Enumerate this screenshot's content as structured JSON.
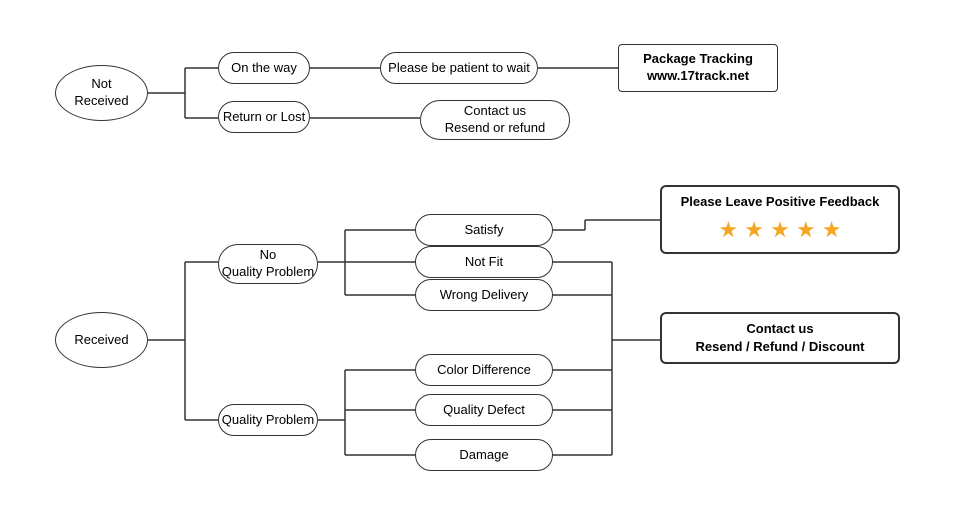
{
  "nodes": {
    "not_received": {
      "label": "Not\nReceived"
    },
    "on_the_way": {
      "label": "On the way"
    },
    "return_or_lost": {
      "label": "Return or Lost"
    },
    "please_patient": {
      "label": "Please be patient to wait"
    },
    "package_tracking": {
      "label": "Package Tracking\nwww.17track.net"
    },
    "contact_resend_refund": {
      "label": "Contact us\nResend or refund"
    },
    "received": {
      "label": "Received"
    },
    "no_quality_problem": {
      "label": "No\nQuality Problem"
    },
    "quality_problem": {
      "label": "Quality Problem"
    },
    "satisfy": {
      "label": "Satisfy"
    },
    "not_fit": {
      "label": "Not Fit"
    },
    "wrong_delivery": {
      "label": "Wrong Delivery"
    },
    "color_difference": {
      "label": "Color Difference"
    },
    "quality_defect": {
      "label": "Quality Defect"
    },
    "damage": {
      "label": "Damage"
    },
    "please_feedback": {
      "label": "Please Leave Positive Feedback"
    },
    "contact_resend_refund_discount": {
      "label": "Contact us\nResend / Refund / Discount"
    },
    "stars": {
      "value": "★ ★ ★ ★ ★"
    }
  }
}
